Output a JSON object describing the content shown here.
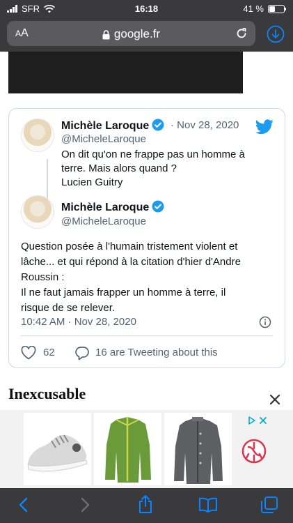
{
  "status": {
    "carrier": "SFR",
    "time": "16:18",
    "battery": "41 %",
    "battery_level": 0.41
  },
  "urlbar": {
    "aa_label_small": "A",
    "aa_label_big": "A",
    "domain": "google.fr"
  },
  "tweet": {
    "quoted": {
      "name": "Michèle Laroque",
      "handle": "@MicheleLaroque",
      "date": "· Nov 28, 2020",
      "lines": [
        "On dit qu'on ne frappe pas un homme à",
        "terre. Mais alors quand ?",
        "Lucien Guitry"
      ]
    },
    "main": {
      "name": "Michèle Laroque",
      "handle": "@MicheleLaroque",
      "lines": [
        "Question posée à l'humain tristement violent et",
        "lâche... et qui répond à la citation d'hier  d'Andre",
        "Roussin :",
        "Il ne faut jamais frapper un homme à terre, il",
        "risque de se relever."
      ],
      "timestamp": "10:42 AM · Nov 28, 2020",
      "likes": "62",
      "tweeting": "16 are Tweeting about this"
    }
  },
  "article": {
    "headline": "Inexcusable"
  },
  "colors": {
    "twitter_blue": "#1d9bf0",
    "chrome": "#3a3a3c",
    "accent_blue": "#0a84ff"
  },
  "icons": [
    "wifi-icon",
    "lock-icon",
    "reload-icon",
    "download-icon",
    "verified-icon",
    "twitter-bird-icon",
    "info-icon",
    "heart-icon",
    "reply-icon",
    "close-icon",
    "adchoices-icon",
    "back-icon",
    "forward-icon",
    "share-icon",
    "bookmarks-icon",
    "tabs-icon"
  ]
}
